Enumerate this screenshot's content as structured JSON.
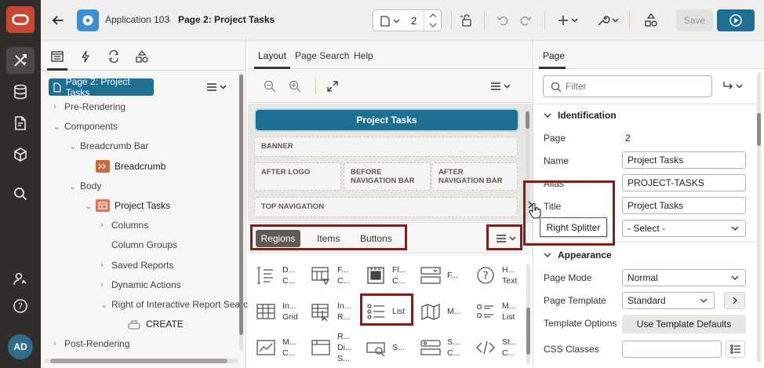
{
  "topbar": {
    "app_name": "Application 103",
    "separator": "\\",
    "page_name": "Page 2: Project Tasks",
    "page_number": "2",
    "save_label": "Save"
  },
  "left_panel": {
    "selected_node": "Page 2: Project Tasks",
    "tree": {
      "pre_rendering": "Pre-Rendering",
      "components": "Components",
      "breadcrumb_bar": "Breadcrumb Bar",
      "breadcrumb": "Breadcrumb",
      "body": "Body",
      "project_tasks": "Project Tasks",
      "columns": "Columns",
      "column_groups": "Column Groups",
      "saved_reports": "Saved Reports",
      "dynamic_actions": "Dynamic Actions",
      "right_of_ir_search": "Right of Interactive Report Searc",
      "create": "CREATE",
      "post_rendering": "Post-Rendering"
    }
  },
  "middle_panel": {
    "tabs": [
      "Layout",
      "Page Search",
      "Help"
    ],
    "region_title": "Project Tasks",
    "slots": {
      "banner": "BANNER",
      "after_logo": "AFTER LOGO",
      "before_nav": "BEFORE NAVIGATION BAR",
      "after_nav": "AFTER NAVIGATION BAR",
      "top_nav": "TOP NAVIGATION"
    },
    "gallery_tabs": [
      "Regions",
      "Items",
      "Buttons"
    ],
    "gallery": [
      {
        "l1": "D...",
        "l2": "C..."
      },
      {
        "l1": "F...",
        "l2": "C..."
      },
      {
        "l1": "Fl...",
        "l2": "C..."
      },
      {
        "l1": "F...",
        "l2": ""
      },
      {
        "l1": "H...",
        "l2": "Text"
      },
      {
        "l1": "In...",
        "l2": "Grid"
      },
      {
        "l1": "In...",
        "l2": "R..."
      },
      {
        "l1": "List",
        "l2": ""
      },
      {
        "l1": "M...",
        "l2": ""
      },
      {
        "l1": "M...",
        "l2": "List"
      },
      {
        "l1": "M...",
        "l2": "C..."
      },
      {
        "l1": "R...",
        "l2": "Di...",
        "l3": "S..."
      },
      {
        "l1": "S...",
        "l2": ""
      },
      {
        "l1": "S...",
        "l2": "C..."
      },
      {
        "l1": "St...",
        "l2": "C..."
      }
    ]
  },
  "right_panel": {
    "tab": "Page",
    "filter_placeholder": "Filter",
    "identification": "Identification",
    "page_label": "Page",
    "page_value": "2",
    "name_label": "Name",
    "name_value": "Project Tasks",
    "alias_label": "Alias",
    "alias_value": "PROJECT-TASKS",
    "title_label": "Title",
    "title_value": "Project Tasks",
    "tooltip": "Right Splitter",
    "select_value": "- Select -",
    "appearance": "Appearance",
    "page_mode_label": "Page Mode",
    "page_mode_value": "Normal",
    "page_template_label": "Page Template",
    "page_template_value": "Standard",
    "template_options_label": "Template Options",
    "template_defaults_button": "Use Template Defaults",
    "css_classes_label": "CSS Classes"
  },
  "user": {
    "initials": "AD"
  },
  "colors": {
    "rail": "#312d2a",
    "brand": "#c74634",
    "accent": "#1f6f93",
    "highlight": "#7b1f1f"
  }
}
